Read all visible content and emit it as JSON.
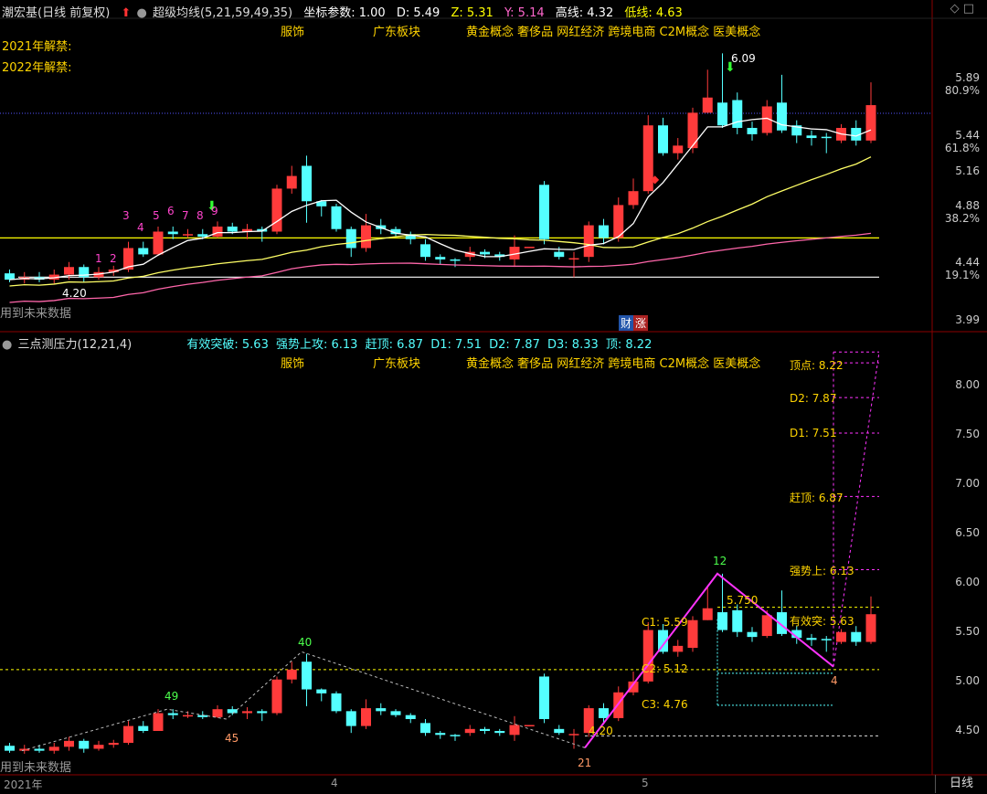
{
  "header1": {
    "stock_name": "潮宏基(日线 前复权)",
    "indicator": "超级均线(5,21,59,49,35)",
    "param_label": "坐标参数: 1.00",
    "d": "D: 5.49",
    "z": "Z: 5.31",
    "y": "Y: 5.14",
    "high": "高线: 4.32",
    "low": "低线: 4.63"
  },
  "lift_2021": "2021年解禁:",
  "lift_2022": "2022年解禁:",
  "concepts_top": [
    "服饰",
    "广东板块",
    "黄金概念 奢侈品 网红经济 跨境电商 C2M概念 医美概念"
  ],
  "concepts_bottom": [
    "服饰",
    "广东板块",
    "黄金概念 奢侈品 网红经济 跨境电商 C2M概念 医美概念"
  ],
  "future_note_top": "用到未来数据",
  "future_note_bottom": "用到未来数据",
  "cai_badge": "财",
  "zhang_badge": "涨",
  "header2": {
    "indicator": "三点测压力(12,21,4)",
    "eff": "有效突破: 5.63",
    "strong": "强势上攻: 6.13",
    "chase": "赶顶: 6.87",
    "d1": "D1: 7.51",
    "d2": "D2: 7.87",
    "d3": "D3: 8.33",
    "top": "顶: 8.22"
  },
  "top_axis": [
    "5.89",
    "80.9%",
    "5.44",
    "61.8%",
    "5.16",
    "4.88",
    "38.2%",
    "4.44",
    "19.1%",
    "3.99"
  ],
  "bottom_axis": [
    "8.00",
    "7.50",
    "7.00",
    "6.50",
    "6.00",
    "5.50",
    "5.00",
    "4.50"
  ],
  "date_labels": [
    "2021年",
    "4",
    "5"
  ],
  "period_button": "日线",
  "annotations": {
    "low_price": "4.20",
    "peak_price": "6.09",
    "bottom_low": "4.20",
    "c1": "C1: 5.59",
    "c2": "C2: 5.12",
    "c3": "C3: 4.76",
    "level_5750": "5.750",
    "eff_label": "有效突: 5.63",
    "strong_label": "强势上: 6.13",
    "chase_label": "赶顶: 6.87",
    "d1_label": "D1: 7.51",
    "d2_label": "D2: 7.87",
    "top_label": "顶点: 8.22",
    "n12": "12",
    "n40": "40",
    "n49": "49",
    "n45": "45",
    "n21": "21",
    "n4": "4",
    "n3": "3",
    "n1": "1",
    "n2": "2",
    "n4b": "4",
    "n5": "5",
    "n6": "6",
    "n7": "7",
    "n8": "8",
    "n9": "9"
  },
  "colors": {
    "up": "#ff3b3b",
    "down": "#54ffff",
    "ma5": "#ffffff",
    "ma21": "#ffff66",
    "ma59": "#ff66aa",
    "hline": "#ffff00",
    "magenta": "#ff33ff",
    "grid": "#8b0000"
  },
  "chart_data": {
    "type": "candlestick",
    "candles": [
      [
        4.35,
        4.3,
        4.38,
        4.28
      ],
      [
        4.3,
        4.32,
        4.36,
        4.27
      ],
      [
        4.32,
        4.3,
        4.36,
        4.28
      ],
      [
        4.3,
        4.34,
        4.38,
        4.27
      ],
      [
        4.34,
        4.4,
        4.44,
        4.3
      ],
      [
        4.4,
        4.32,
        4.42,
        4.28
      ],
      [
        4.32,
        4.36,
        4.4,
        4.3
      ],
      [
        4.36,
        4.38,
        4.41,
        4.33
      ],
      [
        4.38,
        4.55,
        4.6,
        4.36
      ],
      [
        4.55,
        4.5,
        4.6,
        4.48
      ],
      [
        4.5,
        4.68,
        4.72,
        4.5
      ],
      [
        4.68,
        4.66,
        4.72,
        4.62
      ],
      [
        4.65,
        4.66,
        4.7,
        4.63
      ],
      [
        4.66,
        4.64,
        4.7,
        4.62
      ],
      [
        4.64,
        4.72,
        4.76,
        4.63
      ],
      [
        4.72,
        4.68,
        4.75,
        4.66
      ],
      [
        4.68,
        4.7,
        4.74,
        4.62
      ],
      [
        4.7,
        4.68,
        4.72,
        4.6
      ],
      [
        4.68,
        5.02,
        5.05,
        4.66
      ],
      [
        5.02,
        5.12,
        5.2,
        4.98
      ],
      [
        5.2,
        4.92,
        5.28,
        4.75
      ],
      [
        4.92,
        4.88,
        4.93,
        4.8
      ],
      [
        4.88,
        4.7,
        4.9,
        4.68
      ],
      [
        4.7,
        4.55,
        4.72,
        4.48
      ],
      [
        4.55,
        4.73,
        4.82,
        4.52
      ],
      [
        4.73,
        4.7,
        4.78,
        4.66
      ],
      [
        4.7,
        4.66,
        4.72,
        4.64
      ],
      [
        4.66,
        4.62,
        4.68,
        4.58
      ],
      [
        4.58,
        4.48,
        4.62,
        4.45
      ],
      [
        4.48,
        4.46,
        4.5,
        4.42
      ],
      [
        4.46,
        4.45,
        4.47,
        4.4
      ],
      [
        4.48,
        4.52,
        4.56,
        4.45
      ],
      [
        4.52,
        4.5,
        4.54,
        4.47
      ],
      [
        4.5,
        4.48,
        4.52,
        4.45
      ],
      [
        4.46,
        4.56,
        4.65,
        4.4
      ],
      [
        4.56,
        4.56,
        4.56,
        4.56
      ],
      [
        5.05,
        4.62,
        5.08,
        4.58
      ],
      [
        4.52,
        4.48,
        4.56,
        4.46
      ],
      [
        4.46,
        4.47,
        4.52,
        4.32
      ],
      [
        4.48,
        4.73,
        4.76,
        4.44
      ],
      [
        4.73,
        4.63,
        4.78,
        4.58
      ],
      [
        4.63,
        4.89,
        4.95,
        4.6
      ],
      [
        4.89,
        5.0,
        5.1,
        4.86
      ],
      [
        5.0,
        5.52,
        5.6,
        4.98
      ],
      [
        5.52,
        5.3,
        5.58,
        5.28
      ],
      [
        5.3,
        5.36,
        5.42,
        5.25
      ],
      [
        5.34,
        5.62,
        5.66,
        5.3
      ],
      [
        5.62,
        5.74,
        5.96,
        5.62
      ],
      [
        5.7,
        5.52,
        6.09,
        5.5
      ],
      [
        5.72,
        5.5,
        5.78,
        5.45
      ],
      [
        5.5,
        5.45,
        5.55,
        5.4
      ],
      [
        5.46,
        5.67,
        5.72,
        5.44
      ],
      [
        5.7,
        5.48,
        5.92,
        5.46
      ],
      [
        5.52,
        5.44,
        5.56,
        5.38
      ],
      [
        5.44,
        5.42,
        5.48,
        5.36
      ],
      [
        5.43,
        5.42,
        5.46,
        5.3
      ],
      [
        5.4,
        5.5,
        5.53,
        5.38
      ],
      [
        5.5,
        5.4,
        5.56,
        5.36
      ],
      [
        5.4,
        5.68,
        5.86,
        5.38
      ]
    ]
  }
}
